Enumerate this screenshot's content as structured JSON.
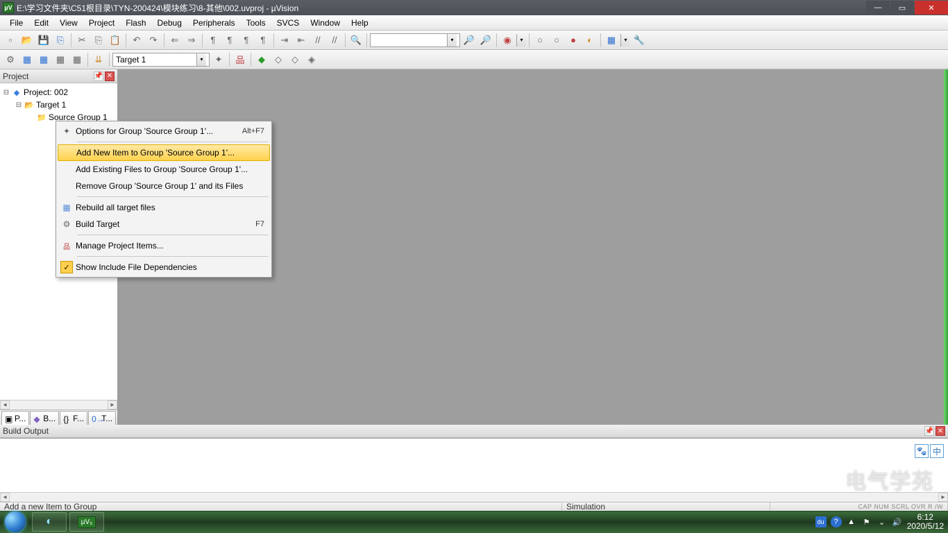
{
  "title": "E:\\学习文件夹\\C51根目录\\TYN-200424\\模块练习\\8-其他\\002.uvproj - µVision",
  "menubar": [
    "File",
    "Edit",
    "View",
    "Project",
    "Flash",
    "Debug",
    "Peripherals",
    "Tools",
    "SVCS",
    "Window",
    "Help"
  ],
  "toolbar2": {
    "target_combo": "Target 1"
  },
  "project_panel": {
    "title": "Project",
    "tree": {
      "project": "Project: 002",
      "target": "Target 1",
      "group": "Source Group 1"
    },
    "tabs": [
      "P...",
      "B...",
      "F...",
      "T..."
    ]
  },
  "context_menu": {
    "items": [
      {
        "icon": "wand",
        "label": "Options for Group 'Source Group 1'...",
        "shortcut": "Alt+F7"
      },
      {
        "sep": true
      },
      {
        "label": "Add New  Item to Group 'Source Group 1'...",
        "highlight": true
      },
      {
        "label": "Add Existing Files to Group 'Source Group 1'..."
      },
      {
        "label": "Remove Group 'Source Group 1' and its Files"
      },
      {
        "sep": true
      },
      {
        "icon": "table",
        "label": "Rebuild all target files"
      },
      {
        "icon": "build",
        "label": "Build Target",
        "shortcut": "F7"
      },
      {
        "sep": true
      },
      {
        "icon": "tree3",
        "label": "Manage Project Items..."
      },
      {
        "sep": true
      },
      {
        "icon": "check",
        "label": "Show Include File Dependencies"
      }
    ]
  },
  "build_output": {
    "title": "Build Output"
  },
  "statusbar": {
    "hint": "Add a new Item to Group",
    "mode": "Simulation",
    "indicators": "CAP   NUM   SCRL   OVR   R /W"
  },
  "float_badges": [
    "🐾",
    "中"
  ],
  "watermark": "电气学苑",
  "taskbar": {
    "tray": {
      "ime": "du",
      "help": "?",
      "up": "▲",
      "flag": "⚑",
      "action": "⌄",
      "vol": "🔊",
      "time": "6:12",
      "date": "2020/5/12"
    }
  }
}
